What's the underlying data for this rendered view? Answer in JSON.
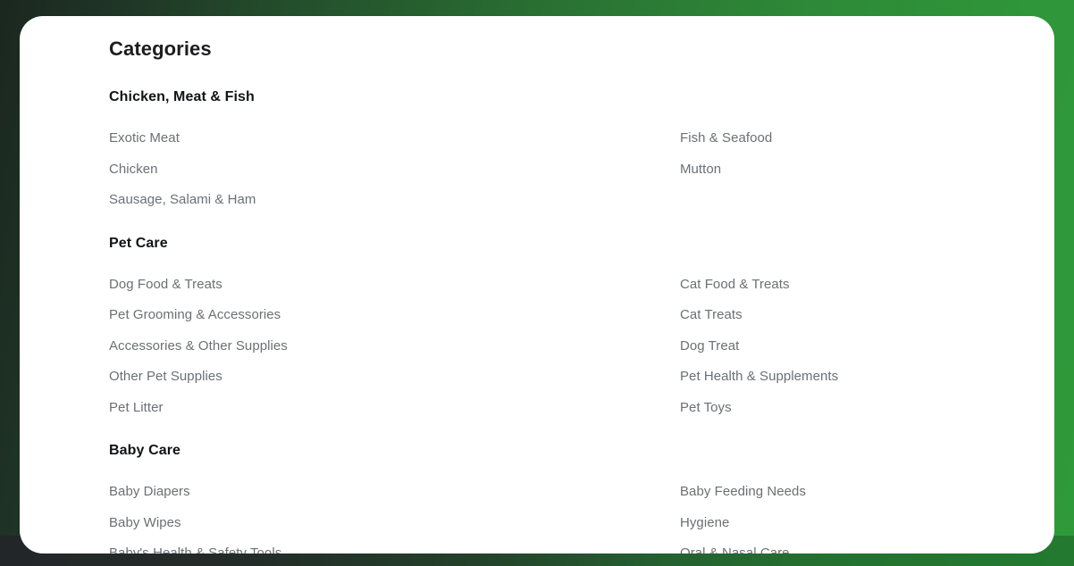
{
  "page": {
    "title": "Categories",
    "accent_color": "#2f9639",
    "card_background": "#ffffff",
    "backdrop_gradient_from": "#1b2720",
    "backdrop_gradient_to": "#2f9a3a",
    "heading_color": "#111315",
    "link_color": "#6b7074"
  },
  "groups": [
    {
      "title": "Chicken, Meat & Fish",
      "left_items": [
        "Exotic Meat",
        "Chicken",
        "Sausage, Salami & Ham"
      ],
      "right_items": [
        "Fish & Seafood",
        "Mutton"
      ]
    },
    {
      "title": "Pet Care",
      "left_items": [
        "Dog Food & Treats",
        "Pet Grooming & Accessories",
        "Accessories & Other Supplies",
        "Other Pet Supplies",
        "Pet Litter"
      ],
      "right_items": [
        "Cat Food & Treats",
        "Cat Treats",
        "Dog Treat",
        "Pet Health & Supplements",
        "Pet Toys"
      ]
    },
    {
      "title": "Baby Care",
      "left_items": [
        "Baby Diapers",
        "Baby Wipes",
        "Baby's Health & Safety Tools"
      ],
      "right_items": [
        "Baby Feeding Needs",
        "Hygiene",
        "Oral & Nasal Care"
      ]
    }
  ]
}
